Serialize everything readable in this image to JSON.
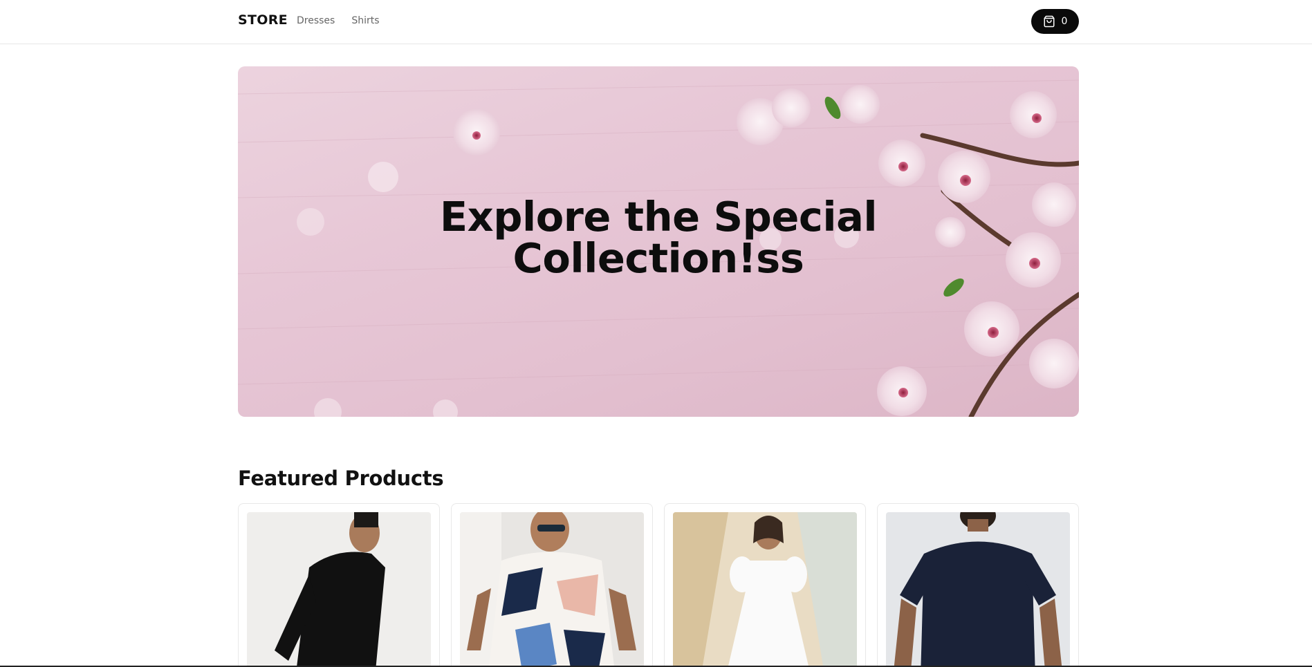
{
  "header": {
    "logo": "STORE",
    "nav": [
      "Dresses",
      "Shirts"
    ],
    "cart": {
      "icon": "shopping-bag-icon",
      "count": "0"
    }
  },
  "hero": {
    "title_line1": "Explore the Special",
    "title_line2": "Collection!ss",
    "background": "pink wooden surface with cherry blossoms"
  },
  "featured": {
    "title": "Featured Products",
    "products": [
      {
        "image": "man in black long-sleeve t-shirt"
      },
      {
        "image": "man in geometric print short-sleeve shirt"
      },
      {
        "image": "woman in white puff-sleeve dress"
      },
      {
        "image": "man in navy t-shirt, back view"
      }
    ]
  },
  "colors": {
    "accent": "#0a0a0a",
    "hero_bg": "#e7c7d6",
    "border": "#e6e6e6"
  }
}
